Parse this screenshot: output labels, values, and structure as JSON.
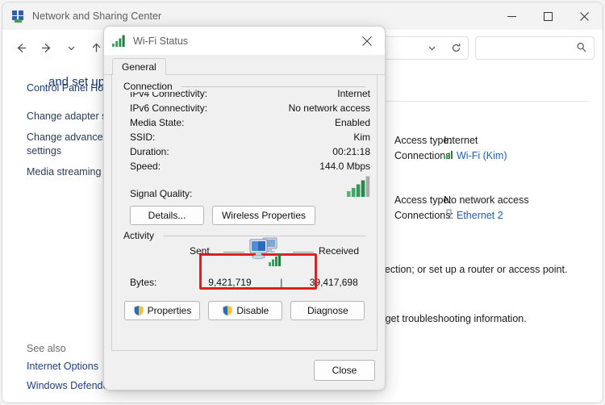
{
  "window": {
    "title": "Network and Sharing Center",
    "icon": "network-sharing-icon",
    "controls": {
      "minimize": "—",
      "maximize": "□",
      "close": "✕"
    },
    "toolbar": {
      "back": "back-arrow-icon",
      "forward": "forward-arrow-icon",
      "recent": "chevron-down-icon",
      "up": "up-arrow-icon",
      "address_dropdown": "chevron-down-icon",
      "refresh": "refresh-icon",
      "search_icon": "search-icon"
    }
  },
  "sidebar": {
    "home": "Control Panel Hor",
    "links": [
      "Change adapter se",
      "Change advanced",
      "settings",
      "Media streaming o"
    ],
    "see_also_title": "See also",
    "see_also": [
      "Internet Options",
      "Windows Defende"
    ]
  },
  "main": {
    "heading": "and set up connections",
    "networks": [
      {
        "access_label": "Access type:",
        "access_value": "Internet",
        "conn_label": "Connections:",
        "conn_value": "Wi-Fi (Kim)",
        "conn_icon": "wifi-signal-icon"
      },
      {
        "access_label": "Access type:",
        "access_value": "No network access",
        "conn_label": "Connections:",
        "conn_value": "Ethernet 2",
        "conn_icon": "ethernet-icon"
      }
    ],
    "tail_lines": [
      "nnection; or set up a router or access point.",
      "or get troubleshooting information."
    ]
  },
  "dialog": {
    "title": "Wi-Fi Status",
    "icon": "wifi-signal-icon",
    "close_icon": "close-icon",
    "tab": "General",
    "connection": {
      "group_label": "Connection",
      "rows": [
        {
          "label": "IPv4 Connectivity:",
          "value": "Internet"
        },
        {
          "label": "IPv6 Connectivity:",
          "value": "No network access"
        },
        {
          "label": "Media State:",
          "value": "Enabled"
        },
        {
          "label": "SSID:",
          "value": "Kim"
        },
        {
          "label": "Duration:",
          "value": "00:21:18"
        },
        {
          "label": "Speed:",
          "value": "144.0 Mbps"
        }
      ],
      "signal_label": "Signal Quality:",
      "signal_icon": "signal-bars-icon",
      "signal_bars_filled": 4,
      "signal_bars_total": 5,
      "buttons": {
        "details": "Details...",
        "wireless_properties": "Wireless Properties"
      },
      "highlight_color": "#e02020"
    },
    "activity": {
      "group_label": "Activity",
      "sent_label": "Sent",
      "received_label": "Received",
      "center_icon": "two-computers-icon",
      "bytes_label": "Bytes:",
      "bytes_sent": "9,421,719",
      "bytes_separator": "|",
      "bytes_received": "39,417,698"
    },
    "buttons": {
      "properties": "Properties",
      "properties_icon": "uac-shield-icon",
      "disable": "Disable",
      "disable_icon": "uac-shield-icon",
      "diagnose": "Diagnose",
      "close": "Close"
    }
  },
  "colors": {
    "accent_link": "#1f5fa9",
    "heading": "#1b3a6b",
    "highlight": "#e02020",
    "signal_green": "#2f9e4f"
  }
}
